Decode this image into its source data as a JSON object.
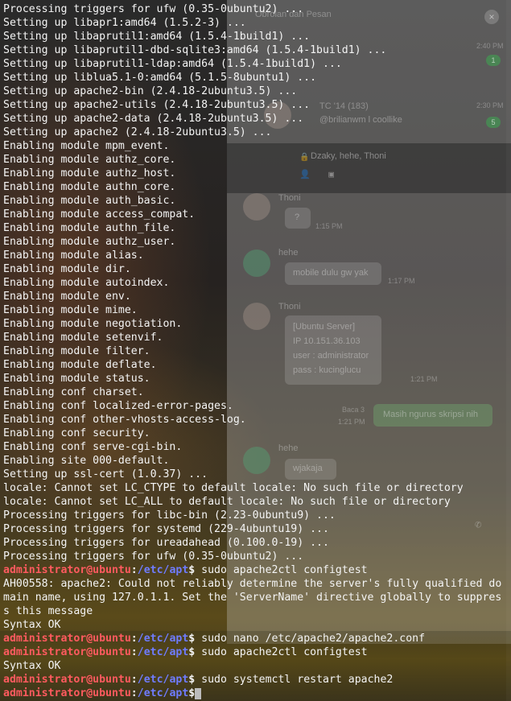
{
  "terminal": {
    "lines": [
      {
        "kind": "text",
        "text": "Processing triggers for ufw (0.35-0ubuntu2) ..."
      },
      {
        "kind": "text",
        "text": "Setting up libapr1:amd64 (1.5.2-3) ..."
      },
      {
        "kind": "text",
        "text": "Setting up libaprutil1:amd64 (1.5.4-1build1) ..."
      },
      {
        "kind": "text",
        "text": "Setting up libaprutil1-dbd-sqlite3:amd64 (1.5.4-1build1) ..."
      },
      {
        "kind": "text",
        "text": "Setting up libaprutil1-ldap:amd64 (1.5.4-1build1) ..."
      },
      {
        "kind": "text",
        "text": "Setting up liblua5.1-0:amd64 (5.1.5-8ubuntu1) ..."
      },
      {
        "kind": "text",
        "text": "Setting up apache2-bin (2.4.18-2ubuntu3.5) ..."
      },
      {
        "kind": "text",
        "text": "Setting up apache2-utils (2.4.18-2ubuntu3.5) ..."
      },
      {
        "kind": "text",
        "text": "Setting up apache2-data (2.4.18-2ubuntu3.5) ..."
      },
      {
        "kind": "text",
        "text": "Setting up apache2 (2.4.18-2ubuntu3.5) ..."
      },
      {
        "kind": "text",
        "text": "Enabling module mpm_event."
      },
      {
        "kind": "text",
        "text": "Enabling module authz_core."
      },
      {
        "kind": "text",
        "text": "Enabling module authz_host."
      },
      {
        "kind": "text",
        "text": "Enabling module authn_core."
      },
      {
        "kind": "text",
        "text": "Enabling module auth_basic."
      },
      {
        "kind": "text",
        "text": "Enabling module access_compat."
      },
      {
        "kind": "text",
        "text": "Enabling module authn_file."
      },
      {
        "kind": "text",
        "text": "Enabling module authz_user."
      },
      {
        "kind": "text",
        "text": "Enabling module alias."
      },
      {
        "kind": "text",
        "text": "Enabling module dir."
      },
      {
        "kind": "text",
        "text": "Enabling module autoindex."
      },
      {
        "kind": "text",
        "text": "Enabling module env."
      },
      {
        "kind": "text",
        "text": "Enabling module mime."
      },
      {
        "kind": "text",
        "text": "Enabling module negotiation."
      },
      {
        "kind": "text",
        "text": "Enabling module setenvif."
      },
      {
        "kind": "text",
        "text": "Enabling module filter."
      },
      {
        "kind": "text",
        "text": "Enabling module deflate."
      },
      {
        "kind": "text",
        "text": "Enabling module status."
      },
      {
        "kind": "text",
        "text": "Enabling conf charset."
      },
      {
        "kind": "text",
        "text": "Enabling conf localized-error-pages."
      },
      {
        "kind": "text",
        "text": "Enabling conf other-vhosts-access-log."
      },
      {
        "kind": "text",
        "text": "Enabling conf security."
      },
      {
        "kind": "text",
        "text": "Enabling conf serve-cgi-bin."
      },
      {
        "kind": "text",
        "text": "Enabling site 000-default."
      },
      {
        "kind": "text",
        "text": "Setting up ssl-cert (1.0.37) ..."
      },
      {
        "kind": "text",
        "text": "locale: Cannot set LC_CTYPE to default locale: No such file or directory"
      },
      {
        "kind": "text",
        "text": "locale: Cannot set LC_ALL to default locale: No such file or directory"
      },
      {
        "kind": "text",
        "text": "Processing triggers for libc-bin (2.23-0ubuntu9) ..."
      },
      {
        "kind": "text",
        "text": "Processing triggers for systemd (229-4ubuntu19) ..."
      },
      {
        "kind": "text",
        "text": "Processing triggers for ureadahead (0.100.0-19) ..."
      },
      {
        "kind": "text",
        "text": "Processing triggers for ufw (0.35-0ubuntu2) ..."
      },
      {
        "kind": "prompt",
        "user": "administrator@ubuntu",
        "colon": ":",
        "path": "/etc/apt",
        "dollar": "$",
        "cmd": " sudo apache2ctl configtest"
      },
      {
        "kind": "text",
        "text": "AH00558: apache2: Could not reliably determine the server's fully qualified do"
      },
      {
        "kind": "text",
        "text": "main name, using 127.0.1.1. Set the 'ServerName' directive globally to suppres"
      },
      {
        "kind": "text",
        "text": "s this message"
      },
      {
        "kind": "text",
        "text": "Syntax OK"
      },
      {
        "kind": "prompt",
        "user": "administrator@ubuntu",
        "colon": ":",
        "path": "/etc/apt",
        "dollar": "$",
        "cmd": " sudo nano /etc/apache2/apache2.conf"
      },
      {
        "kind": "prompt",
        "user": "administrator@ubuntu",
        "colon": ":",
        "path": "/etc/apt",
        "dollar": "$",
        "cmd": " sudo apache2ctl configtest"
      },
      {
        "kind": "text",
        "text": "Syntax OK"
      },
      {
        "kind": "prompt",
        "user": "administrator@ubuntu",
        "colon": ":",
        "path": "/etc/apt",
        "dollar": "$",
        "cmd": " sudo systemctl restart apache2"
      },
      {
        "kind": "prompt",
        "user": "administrator@ubuntu",
        "colon": ":",
        "path": "/etc/apt",
        "dollar": "$",
        "cmd": "",
        "cursor": true
      }
    ]
  },
  "background_chat": {
    "header": "Obrolan dan Pesan",
    "contacts": [
      {
        "name": "TC '14 (183)",
        "snippet": "@brilianwm l coollike",
        "time": "2:30 PM",
        "badge": "5"
      }
    ],
    "first_time": "2:40 PM",
    "first_badge": "1",
    "room_title": "Dzaky, hehe, Thoni",
    "messages": [
      {
        "sender": "Thoni",
        "text": "?",
        "time": "1:15 PM"
      },
      {
        "sender": "hehe",
        "text": "mobile dulu gw yak",
        "time": "1:17 PM"
      },
      {
        "sender": "Thoni",
        "lines": [
          "[Ubuntu Server]",
          "IP 10.151.36.103",
          "user : administrator",
          "pass : kucinglucu"
        ],
        "time": "1:21 PM"
      },
      {
        "sender": "",
        "text": "Masih ngurus skripsi nih",
        "time": "1:21 PM",
        "read": "Baca 3"
      },
      {
        "sender": "hehe",
        "text": "wjakaja",
        "time": ""
      }
    ]
  },
  "colors": {
    "prompt_user": "#ff5a5f",
    "prompt_path": "#6f7cff",
    "text": "#f4f4f4",
    "background": "#1b1b1b"
  },
  "icons": [
    "close-icon",
    "phone-icon",
    "lock-icon"
  ]
}
